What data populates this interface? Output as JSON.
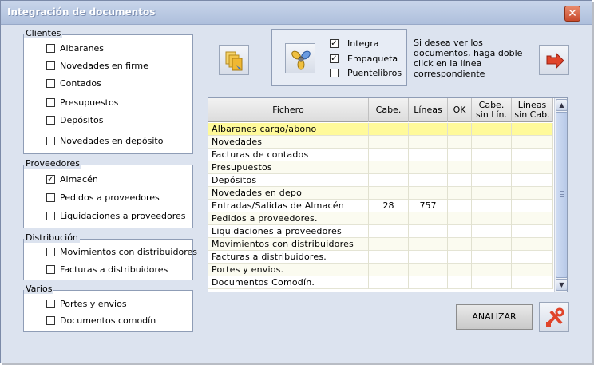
{
  "window": {
    "title": "Integración de documentos",
    "close_label": "✕"
  },
  "groups": {
    "clientes": {
      "legend": "Clientes",
      "items": [
        {
          "label": "Albaranes",
          "checked": false
        },
        {
          "label": "Novedades en firme",
          "checked": false
        },
        {
          "label": "Contados",
          "checked": false
        },
        {
          "label": "Presupuestos",
          "checked": false
        },
        {
          "label": "Depósitos",
          "checked": false
        },
        {
          "label": "Novedades en depósito",
          "checked": false
        }
      ]
    },
    "proveedores": {
      "legend": "Proveedores",
      "items": [
        {
          "label": "Almacén",
          "checked": true
        },
        {
          "label": "Pedidos a proveedores",
          "checked": false
        },
        {
          "label": "Liquidaciones a proveedores",
          "checked": false
        }
      ]
    },
    "distribucion": {
      "legend": "Distribución",
      "items": [
        {
          "label": "Movimientos con distribuidores",
          "checked": false
        },
        {
          "label": "Facturas a distribuidores",
          "checked": false
        }
      ]
    },
    "varios": {
      "legend": "Varios",
      "items": [
        {
          "label": "Portes y envios",
          "checked": false
        },
        {
          "label": "Documentos comodín",
          "checked": false
        }
      ]
    }
  },
  "options": [
    {
      "label": "Integra",
      "checked": true
    },
    {
      "label": "Empaqueta",
      "checked": true
    },
    {
      "label": "Puentelibros",
      "checked": false
    }
  ],
  "check_mark": "✓",
  "info_text": "Si desea ver los documentos, haga doble click en la línea correspondiente",
  "icons": {
    "documents": "documents-icon",
    "propeller": "propeller-icon",
    "exit": "exit-arrow-icon",
    "tools": "tools-icon"
  },
  "grid": {
    "columns": [
      "Fichero",
      "Cabe.",
      "Líneas",
      "OK",
      "Cabe.\nsin Lín.",
      "Líneas\nsin Cab."
    ],
    "rows": [
      {
        "name": "Albaranes cargo/abono",
        "cabe": "",
        "lineas": "",
        "ok": "",
        "cabe_sin": "",
        "lineas_sin": ""
      },
      {
        "name": "Novedades",
        "cabe": "",
        "lineas": "",
        "ok": "",
        "cabe_sin": "",
        "lineas_sin": ""
      },
      {
        "name": "Facturas de contados",
        "cabe": "",
        "lineas": "",
        "ok": "",
        "cabe_sin": "",
        "lineas_sin": ""
      },
      {
        "name": "Presupuestos",
        "cabe": "",
        "lineas": "",
        "ok": "",
        "cabe_sin": "",
        "lineas_sin": ""
      },
      {
        "name": "Depósitos",
        "cabe": "",
        "lineas": "",
        "ok": "",
        "cabe_sin": "",
        "lineas_sin": ""
      },
      {
        "name": "Novedades en depo",
        "cabe": "",
        "lineas": "",
        "ok": "",
        "cabe_sin": "",
        "lineas_sin": ""
      },
      {
        "name": "Entradas/Salidas de Almacén",
        "cabe": "28",
        "lineas": "757",
        "ok": "",
        "cabe_sin": "",
        "lineas_sin": ""
      },
      {
        "name": "Pedidos a proveedores.",
        "cabe": "",
        "lineas": "",
        "ok": "",
        "cabe_sin": "",
        "lineas_sin": ""
      },
      {
        "name": "Liquidaciones a proveedores",
        "cabe": "",
        "lineas": "",
        "ok": "",
        "cabe_sin": "",
        "lineas_sin": ""
      },
      {
        "name": "Movimientos con distribuidores",
        "cabe": "",
        "lineas": "",
        "ok": "",
        "cabe_sin": "",
        "lineas_sin": ""
      },
      {
        "name": "Facturas a distribuidores.",
        "cabe": "",
        "lineas": "",
        "ok": "",
        "cabe_sin": "",
        "lineas_sin": ""
      },
      {
        "name": "Portes y envios.",
        "cabe": "",
        "lineas": "",
        "ok": "",
        "cabe_sin": "",
        "lineas_sin": ""
      },
      {
        "name": "Documentos Comodín.",
        "cabe": "",
        "lineas": "",
        "ok": "",
        "cabe_sin": "",
        "lineas_sin": ""
      }
    ],
    "selected_row": 0
  },
  "analyze_label": "ANALIZAR",
  "colors": {
    "selected_row": "#fffa9a",
    "window_bg": "#dce3ef",
    "accent_red": "#e0442a"
  }
}
